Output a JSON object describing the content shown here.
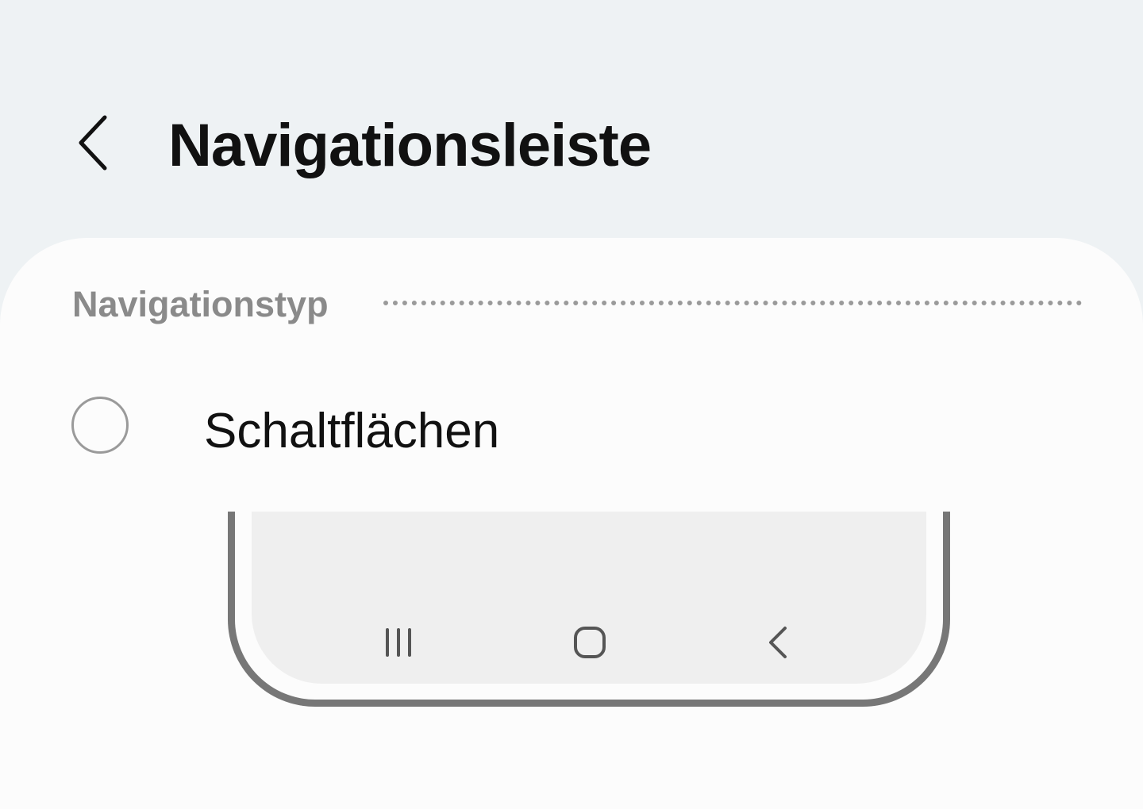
{
  "header": {
    "back_icon": "chevron-left-icon",
    "title": "Navigationsleiste"
  },
  "section": {
    "label": "Navigationstyp"
  },
  "options": [
    {
      "label": "Schaltflächen",
      "selected": false
    }
  ],
  "preview": {
    "nav_keys": [
      "recents-icon",
      "home-icon",
      "back-icon"
    ]
  },
  "colors": {
    "background": "#eef2f4",
    "card": "#fcfcfc",
    "title_text": "#111111",
    "section_label": "#8a8a8a",
    "radio_border": "#9a9a9a",
    "phone_frame": "#777777",
    "phone_screen": "#efefef"
  }
}
